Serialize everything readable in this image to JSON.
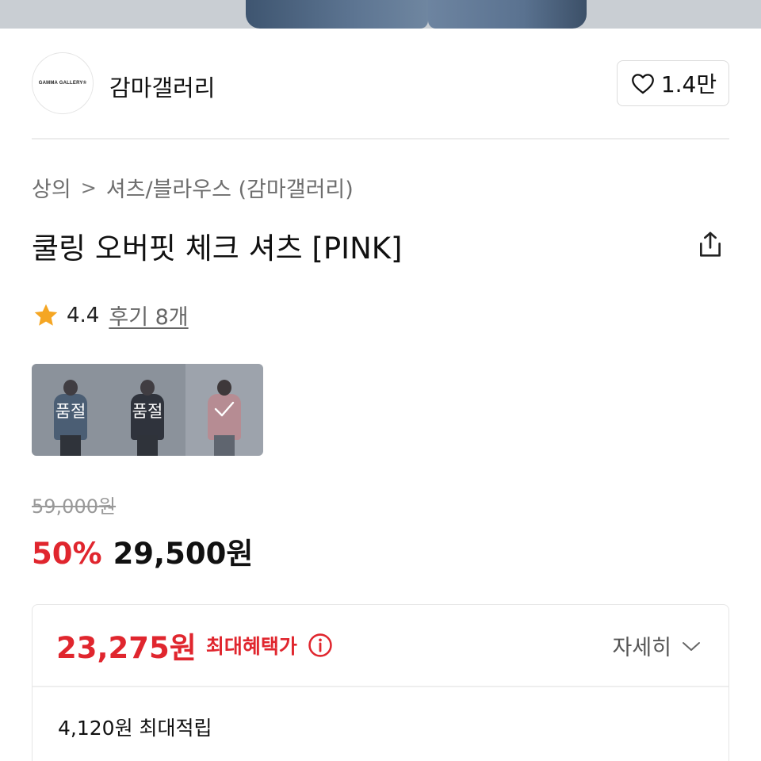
{
  "brand": {
    "logo_text": "GAMMA GALLERY®",
    "name": "감마갤러리",
    "like_count": "1.4만"
  },
  "breadcrumb": {
    "category": "상의",
    "separator": ">",
    "subcategory": "셔츠/블라우스 (감마갤러리)"
  },
  "product": {
    "title": "쿨링 오버핏 체크 셔츠 [PINK]",
    "rating": "4.4",
    "review_link": "후기 8개"
  },
  "color_options": [
    {
      "color": "#4f6a86",
      "status": "품절",
      "selected": false
    },
    {
      "color": "#1d1d1f",
      "status": "품절",
      "selected": false
    },
    {
      "color": "#e7a7a9",
      "status": "",
      "selected": true
    }
  ],
  "price": {
    "original": "59,000원",
    "discount": "50%",
    "sale": "29,500원"
  },
  "benefit": {
    "max_price": "23,275원",
    "max_label": "최대혜택가",
    "detail_label": "자세히",
    "points": "4,120원 최대적립"
  },
  "colors": {
    "accent_red": "#e0262e",
    "star": "#f5a623"
  }
}
